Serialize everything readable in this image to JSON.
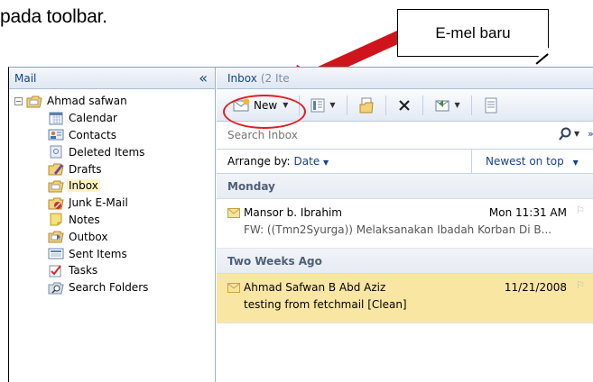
{
  "caption": "pada toolbar.",
  "callout": {
    "text": "E-mel baru"
  },
  "nav": {
    "title": "Mail",
    "collapse_glyph": "«",
    "expander_glyph": "−",
    "account": "Ahmad safwan",
    "folders": [
      {
        "label": "Calendar",
        "icon": "calendar-icon"
      },
      {
        "label": "Contacts",
        "icon": "contacts-icon"
      },
      {
        "label": "Deleted Items",
        "icon": "deleted-items-icon"
      },
      {
        "label": "Drafts",
        "icon": "drafts-icon"
      },
      {
        "label": "Inbox",
        "icon": "inbox-icon",
        "selected": true
      },
      {
        "label": "Junk E-Mail",
        "icon": "junk-icon"
      },
      {
        "label": "Notes",
        "icon": "notes-icon"
      },
      {
        "label": "Outbox",
        "icon": "outbox-icon"
      },
      {
        "label": "Sent Items",
        "icon": "sent-items-icon"
      },
      {
        "label": "Tasks",
        "icon": "tasks-icon"
      },
      {
        "label": "Search Folders",
        "icon": "search-folders-icon"
      }
    ]
  },
  "inbox": {
    "title": "Inbox",
    "count": "(2 Ite",
    "toolbar": {
      "new_label": "New"
    },
    "search": {
      "placeholder": "Search Inbox",
      "more_glyph": "»"
    },
    "arrange": {
      "label": "Arrange by:",
      "value": "Date",
      "sort": "Newest on top"
    },
    "groups": [
      {
        "name": "Monday",
        "messages": [
          {
            "from": "Mansor b. Ibrahim",
            "date": "Mon 11:31 AM",
            "subject": "FW: ((Tmn2Syurga)) Melaksanakan Ibadah Korban Di B..."
          }
        ]
      },
      {
        "name": "Two Weeks Ago",
        "messages": [
          {
            "from": "Ahmad Safwan B Abd Aziz",
            "date": "11/21/2008",
            "subject": "testing from fetchmail [Clean]",
            "selected": true
          }
        ]
      }
    ]
  },
  "colors": {
    "arrow": "#d0141b",
    "highlight_oval": "#e21d24",
    "selected_row": "#f9e6a3",
    "link": "#15428b"
  }
}
